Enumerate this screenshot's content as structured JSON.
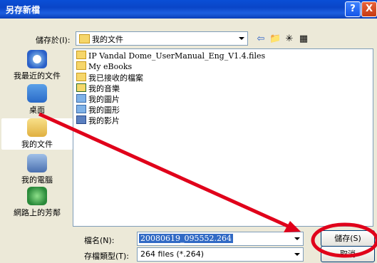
{
  "window": {
    "title": "另存新檔",
    "help_label": "?",
    "close_label": "X"
  },
  "save_in": {
    "label": "儲存於(I):",
    "value": "我的文件"
  },
  "places": [
    {
      "name": "recent",
      "label": "我最近的文件"
    },
    {
      "name": "desktop",
      "label": "桌面"
    },
    {
      "name": "mydocs",
      "label": "我的文件"
    },
    {
      "name": "mycomputer",
      "label": "我的電腦"
    },
    {
      "name": "network",
      "label": "網路上的芳鄰"
    }
  ],
  "files": [
    {
      "name": "IP Vandal Dome_UserManual_Eng_V1.4.files",
      "type": "folder"
    },
    {
      "name": "My eBooks",
      "type": "folder"
    },
    {
      "name": "我已接收的檔案",
      "type": "folder"
    },
    {
      "name": "我的音樂",
      "type": "music"
    },
    {
      "name": "我的圖片",
      "type": "image"
    },
    {
      "name": "我的圖形",
      "type": "image"
    },
    {
      "name": "我的影片",
      "type": "video"
    }
  ],
  "filename": {
    "label": "檔名(N):",
    "value": "20080619_095552.264"
  },
  "filetype": {
    "label": "存檔類型(T):",
    "value": "264 files (*.264)"
  },
  "buttons": {
    "save": "儲存(S)",
    "cancel": "取消"
  },
  "colors": {
    "annotation": "#e0001a",
    "titlebar": "#0a4fd6",
    "selection": "#316ac5"
  }
}
